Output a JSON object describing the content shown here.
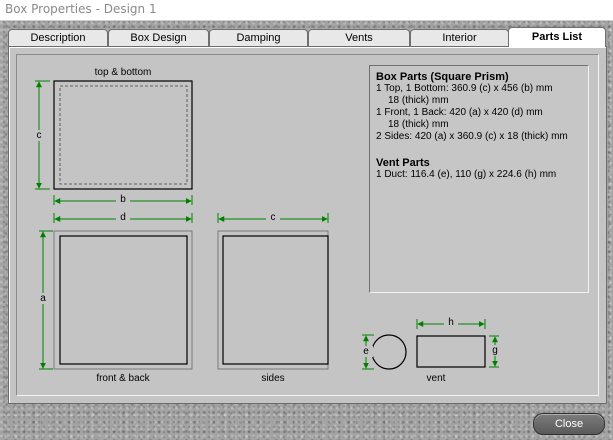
{
  "window": {
    "title": "Box Properties - Design 1"
  },
  "tabs": [
    {
      "label": "Description"
    },
    {
      "label": "Box Design"
    },
    {
      "label": "Damping"
    },
    {
      "label": "Vents"
    },
    {
      "label": "Interior"
    },
    {
      "label": "Parts List",
      "active": true
    }
  ],
  "diagram": {
    "top_bottom_label": "top & bottom",
    "front_back_label": "front & back",
    "sides_label": "sides",
    "vent_label": "vent",
    "dims": {
      "a": "a",
      "b": "b",
      "c": "c",
      "d": "d",
      "e": "e",
      "g": "g",
      "h": "h"
    },
    "dimension_color": "#008000"
  },
  "parts_list": {
    "box_header": "Box Parts (Square Prism)",
    "box_lines": [
      "1 Top, 1 Bottom:  360.9 (c) x 456 (b) mm",
      "18 (thick) mm",
      "1 Front, 1 Back:  420 (a) x 420 (d) mm",
      "18 (thick) mm",
      "2 Sides:  420 (a) x 360.9 (c) x 18 (thick) mm"
    ],
    "vent_header": "Vent Parts",
    "vent_lines": [
      "1 Duct:  116.4 (e), 110 (g) x 224.6 (h) mm"
    ]
  },
  "buttons": {
    "close": "Close"
  }
}
